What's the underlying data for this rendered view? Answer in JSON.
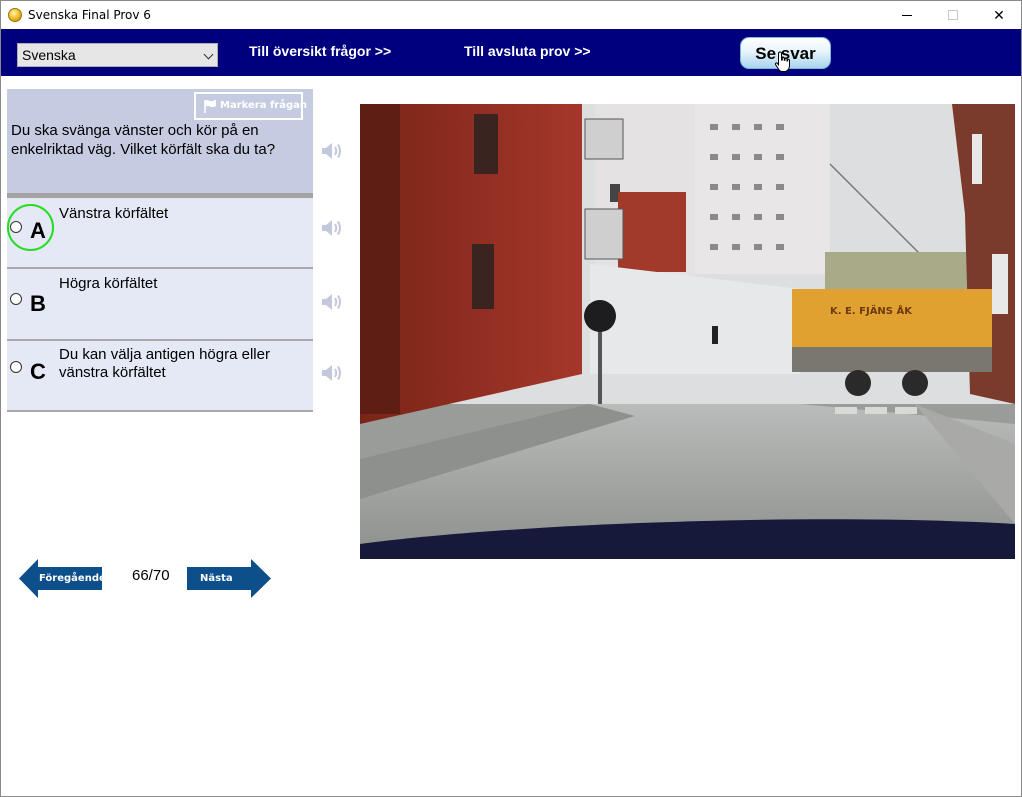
{
  "window": {
    "title": "Svenska Final Prov 6",
    "minimize_icon": "minimize-icon",
    "maximize_icon": "maximize-icon",
    "close_glyph": "✕"
  },
  "toolbar": {
    "language_selected": "Svenska",
    "overview_link": "Till översikt frågor >>",
    "finish_link": "Till avsluta prov  >>",
    "see_answer_button": "Se svar",
    "background_color": "#00007f"
  },
  "question": {
    "flag_button": "Markera frågan",
    "text": "Du ska svänga vänster och kör på en enkelriktad väg. Vilket körfält ska du ta?"
  },
  "answers": [
    {
      "letter": "A",
      "text": "Vänstra körfältet",
      "selected": true
    },
    {
      "letter": "B",
      "text": "Högra körfältet",
      "selected": false
    },
    {
      "letter": "C",
      "text": "Du kan välja antigen högra eller vänstra körfältet",
      "selected": false
    }
  ],
  "navigation": {
    "prev_label": "Föregående",
    "next_label": "Nästa",
    "counter": "66/70"
  },
  "scene": {
    "truck_lettering": "K. E. FJÄNS ÅK"
  },
  "colors": {
    "question_bg": "#c5cbe1",
    "answer_bg": "#e5e9f5",
    "arrow_blue": "#0d4f8b",
    "selected_ring": "#22dd22"
  }
}
